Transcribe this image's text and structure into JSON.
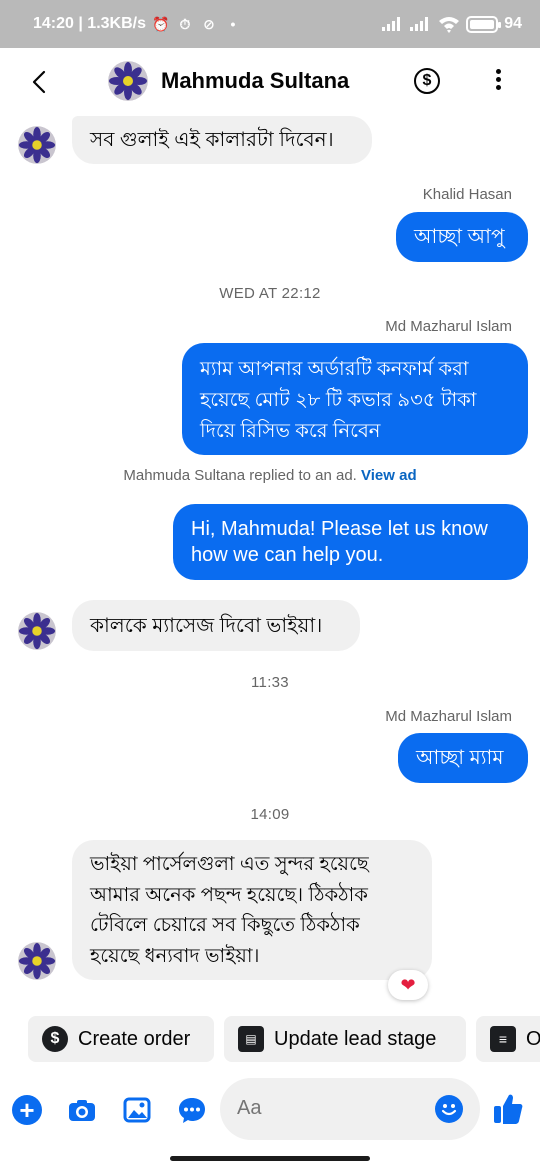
{
  "status_bar": {
    "time_speed": "14:20 | 1.3KB/s",
    "battery": "94",
    "icons": [
      "alarm-off-icon",
      "alarm-icon",
      "do-not-disturb-icon",
      "dot-icon",
      "signal-icon",
      "signal-icon",
      "wifi-icon",
      "battery-icon"
    ]
  },
  "header": {
    "contact_name": "Mahmuda Sultana",
    "icons": [
      "back-icon",
      "dollar-icon",
      "more-icon"
    ]
  },
  "messages": [
    {
      "type": "in",
      "text": "সব গুলাই এই কালারটা দিবেন।"
    },
    {
      "sender": "Khalid Hasan"
    },
    {
      "type": "out",
      "text": "আচ্ছা আপু"
    },
    {
      "time": "WED AT 22:12"
    },
    {
      "sender": "Md Mazharul Islam"
    },
    {
      "type": "out",
      "lines": [
        "ম্যাম আপনার অর্ডারটি কনফার্ম করা",
        "হয়েছে মোট ২৮ টি কভার ৯৩৫ টাকা",
        "দিয়ে  রিসিভ করে নিবেন"
      ]
    },
    {
      "ad_note": "Mahmuda Sultana replied to an ad.",
      "ad_link": "View ad"
    },
    {
      "type": "out",
      "lines": [
        "Hi, Mahmuda! Please let us know",
        "how we can help you."
      ]
    },
    {
      "type": "in",
      "text": "কালকে ম্যাসেজ দিবো ভাইয়া।"
    },
    {
      "time": "11:33"
    },
    {
      "sender": "Md Mazharul Islam"
    },
    {
      "type": "out",
      "text": "আচ্ছা ম্যাম"
    },
    {
      "time": "14:09"
    },
    {
      "type": "in",
      "lines": [
        "ভাইয়া পার্সেলগুলা এত সুন্দর হয়েছে",
        "আমার অনেক পছন্দ হয়েছে। ঠিকঠাক",
        "টেবিলে চেয়ারে সব কিছুতে ঠিকঠাক",
        "হয়েছে ধন্যবাদ ভাইয়া।"
      ],
      "reaction": "heart-icon"
    }
  ],
  "chips": [
    {
      "label": "Create order",
      "icon": "dollar-icon"
    },
    {
      "label": "Update lead stage",
      "icon": "id-card-icon"
    },
    {
      "label": "O",
      "icon": "document-icon"
    }
  ],
  "composer": {
    "placeholder": "Aa",
    "icons": [
      "plus-icon",
      "camera-icon",
      "image-icon",
      "chat-bubble-icon",
      "emoji-icon",
      "like-icon"
    ]
  },
  "colors": {
    "accent": "#0a6cf0",
    "incoming_bubble": "#f0f0f0",
    "status_bar": "#b9b9b9",
    "meta_text": "#656565"
  }
}
